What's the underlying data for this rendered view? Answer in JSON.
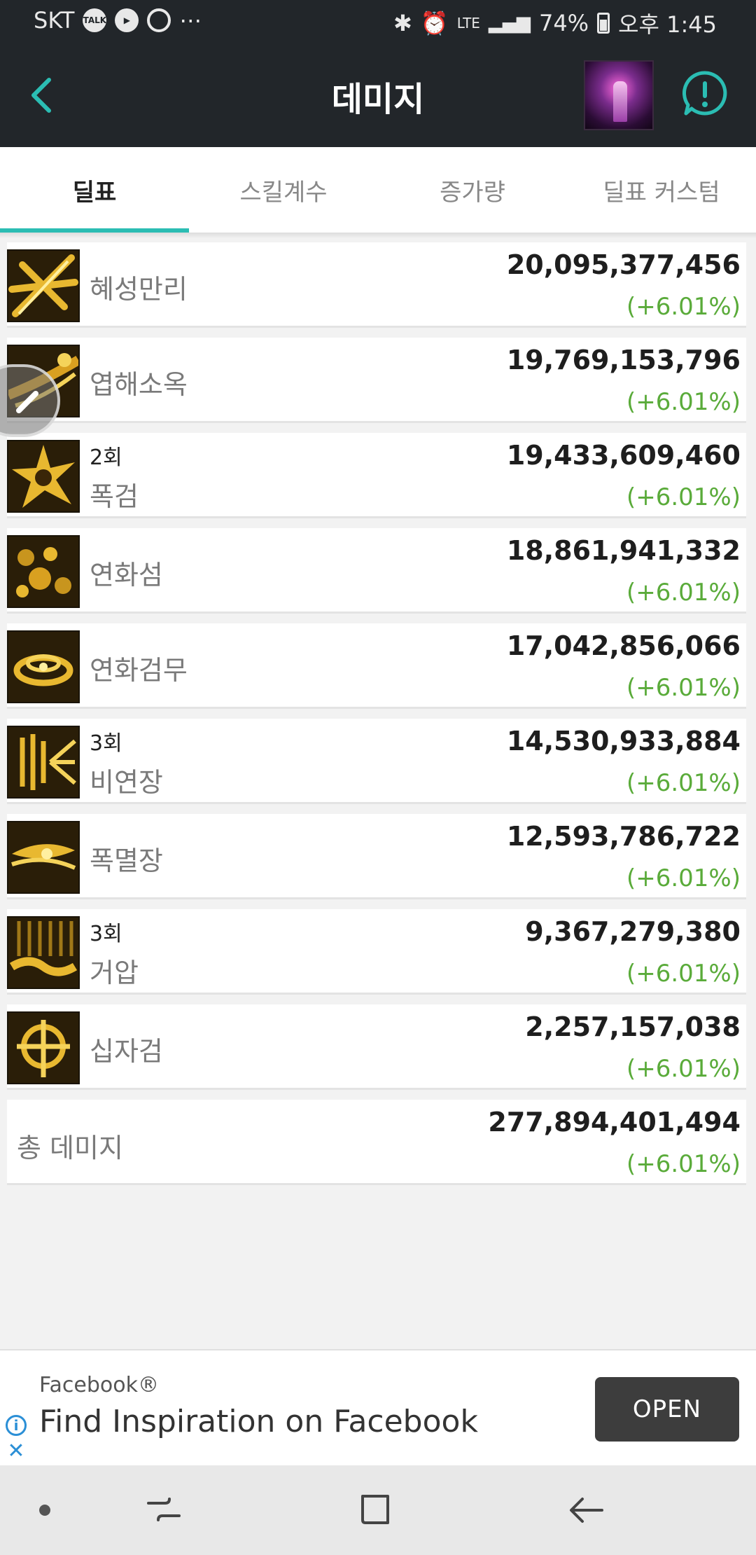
{
  "status_bar": {
    "carrier": "SKT",
    "left_icons": [
      "talk-icon",
      "play-icon",
      "sync-icon"
    ],
    "more": "⋯",
    "right_icons": [
      "bluetooth-icon",
      "alarm-icon",
      "signal-icon"
    ],
    "network": "LTE",
    "battery": "74%",
    "time": "오후 1:45"
  },
  "header": {
    "title": "데미지"
  },
  "tabs": [
    {
      "label": "딜표",
      "active": true
    },
    {
      "label": "스킬계수",
      "active": false
    },
    {
      "label": "증가량",
      "active": false
    },
    {
      "label": "딜표 커스텀",
      "active": false
    }
  ],
  "skills": [
    {
      "name": "혜성만리",
      "hits": "",
      "damage": "20,095,377,456",
      "change": "(+6.01%)",
      "icon": "comet-skill-icon"
    },
    {
      "name": "엽해소옥",
      "hits": "",
      "damage": "19,769,153,796",
      "change": "(+6.01%)",
      "icon": "leaf-skill-icon"
    },
    {
      "name": "폭검",
      "hits": "2회",
      "damage": "19,433,609,460",
      "change": "(+6.01%)",
      "icon": "burst-sword-skill-icon"
    },
    {
      "name": "연화섬",
      "hits": "",
      "damage": "18,861,941,332",
      "change": "(+6.01%)",
      "icon": "lotus-flash-skill-icon"
    },
    {
      "name": "연화검무",
      "hits": "",
      "damage": "17,042,856,066",
      "change": "(+6.01%)",
      "icon": "lotus-dance-skill-icon"
    },
    {
      "name": "비연장",
      "hits": "3회",
      "damage": "14,530,933,884",
      "change": "(+6.01%)",
      "icon": "flying-palm-skill-icon"
    },
    {
      "name": "폭멸장",
      "hits": "",
      "damage": "12,593,786,722",
      "change": "(+6.01%)",
      "icon": "destruction-palm-skill-icon"
    },
    {
      "name": "거압",
      "hits": "3회",
      "damage": "9,367,279,380",
      "change": "(+6.01%)",
      "icon": "giant-press-skill-icon"
    },
    {
      "name": "십자검",
      "hits": "",
      "damage": "2,257,157,038",
      "change": "(+6.01%)",
      "icon": "cross-sword-skill-icon"
    }
  ],
  "total": {
    "label": "총 데미지",
    "damage": "277,894,401,494",
    "change": "(+6.01%)"
  },
  "ad": {
    "advertiser": "Facebook®",
    "headline": "Find Inspiration on Facebook",
    "cta": "OPEN",
    "info_icon": "info-icon",
    "close_icon": "close-icon"
  },
  "colors": {
    "accent": "#2bbdb3",
    "header_bg": "#22262a",
    "increase": "#5aab3a"
  }
}
